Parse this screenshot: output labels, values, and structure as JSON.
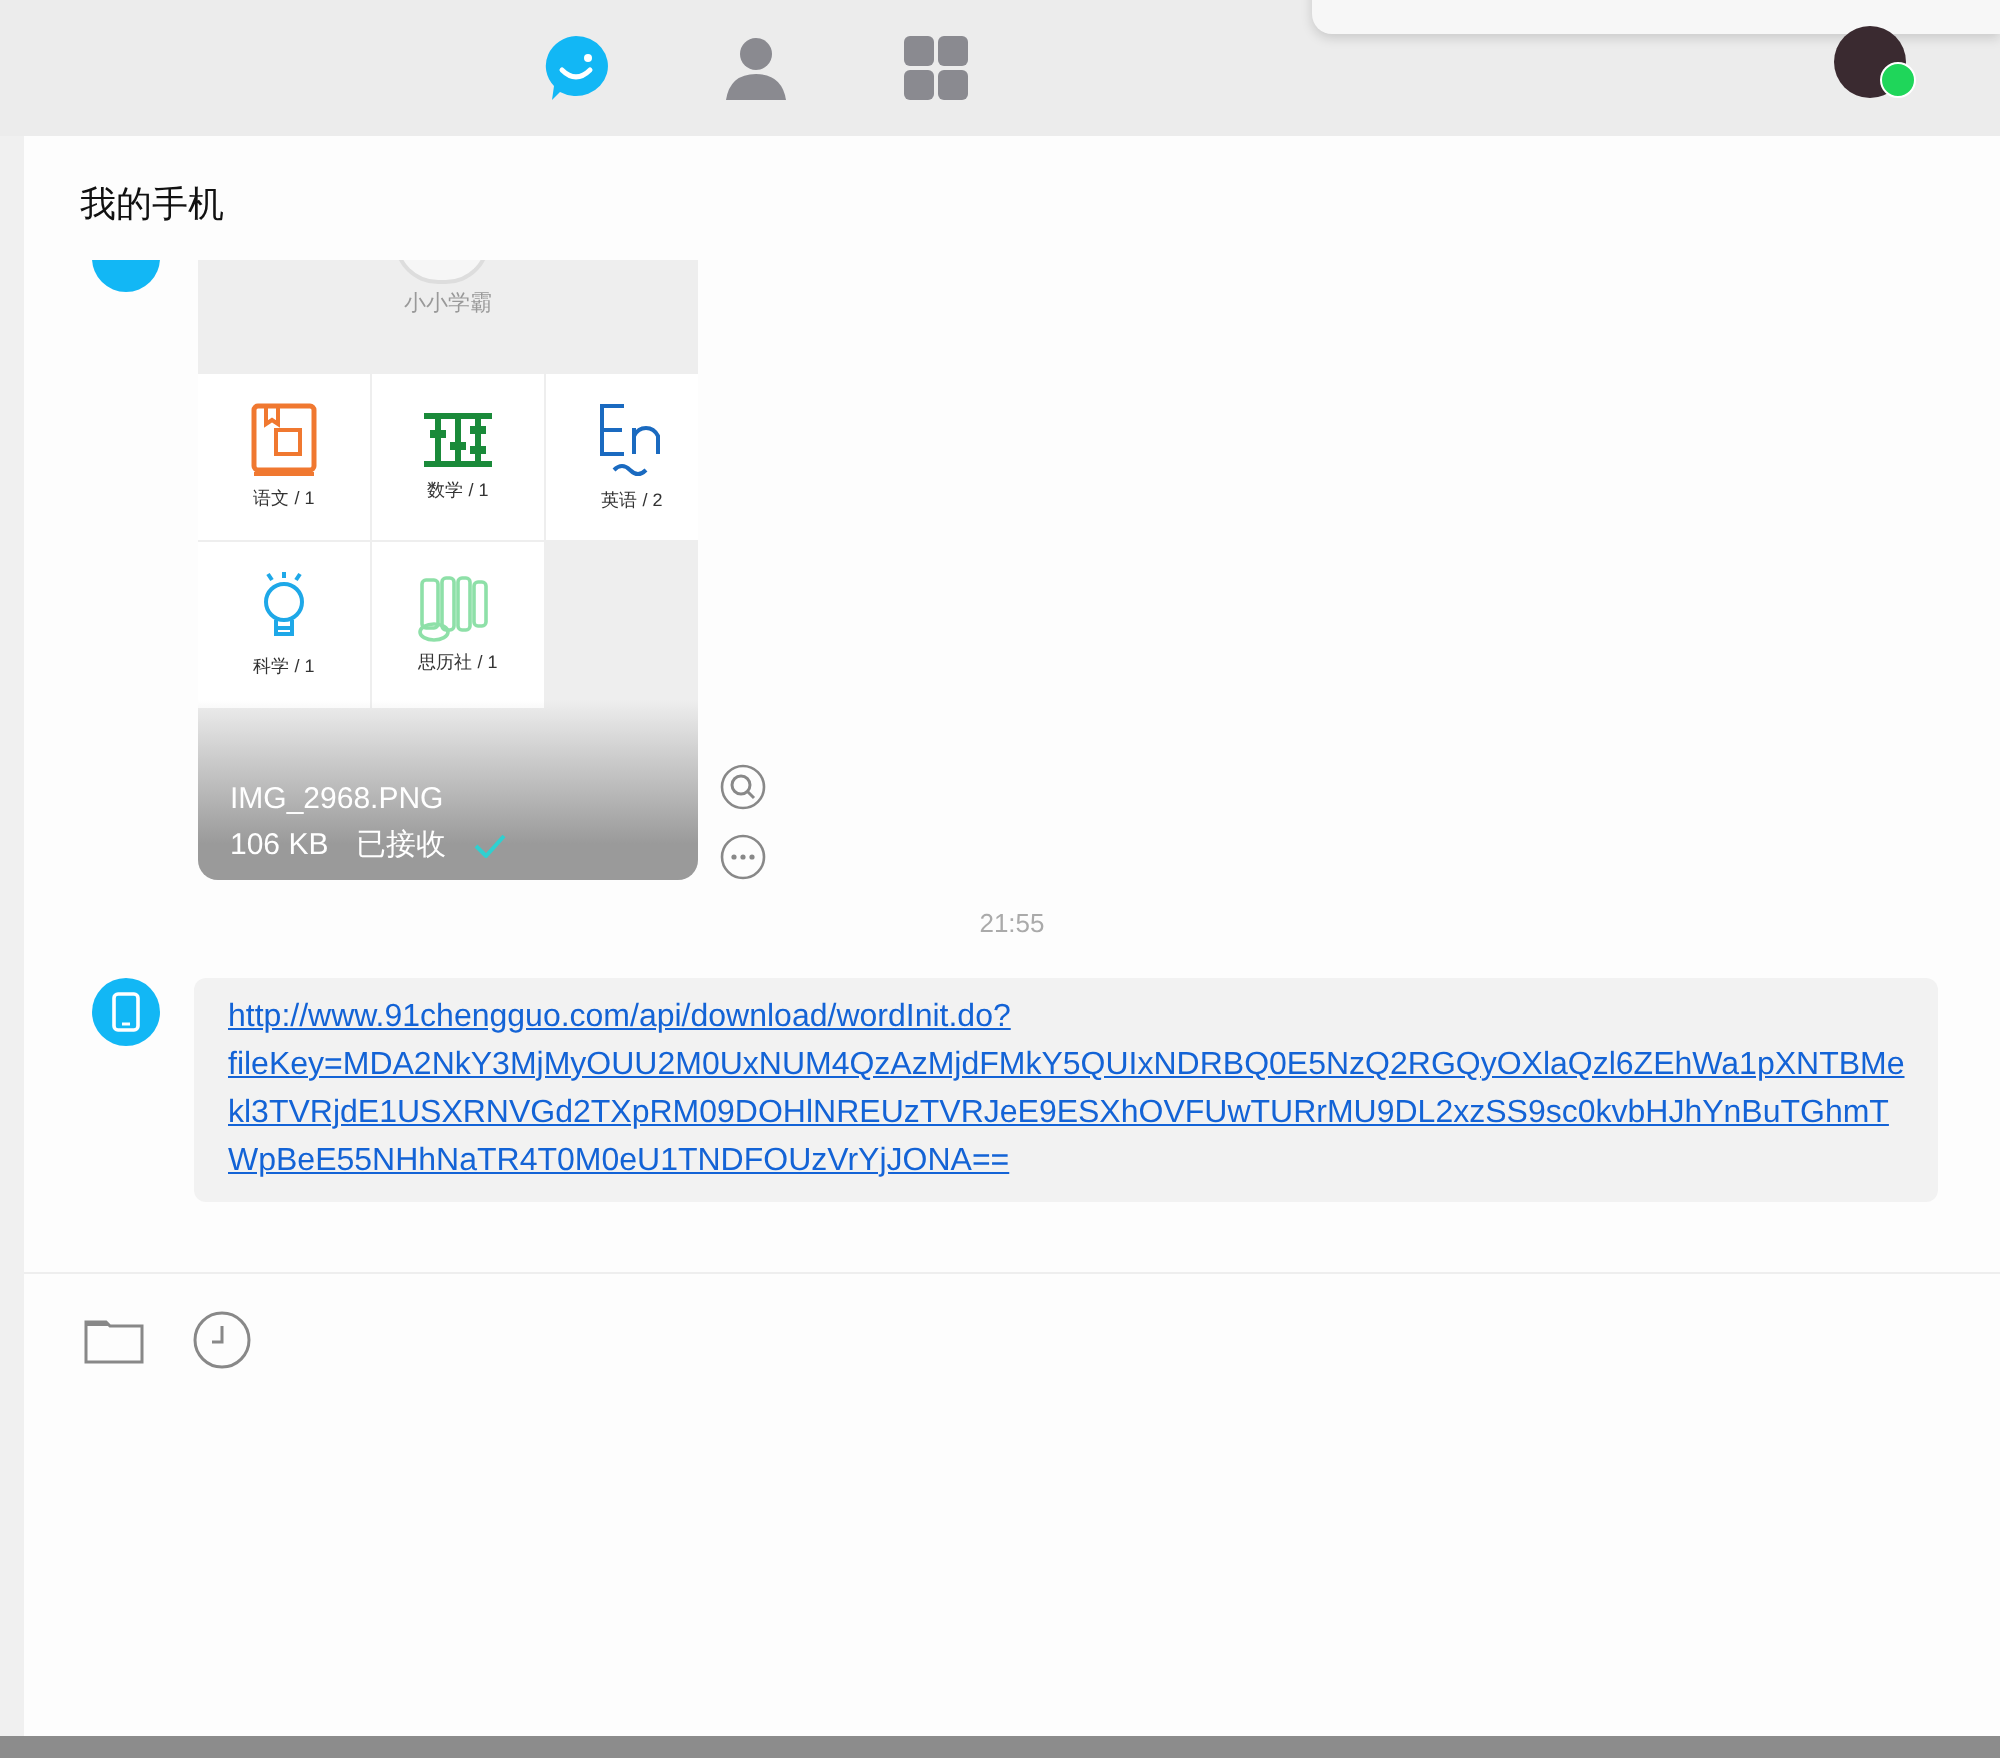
{
  "nav_tabs": [
    {
      "kind": "chat",
      "selected": true
    },
    {
      "kind": "contacts",
      "selected": false
    },
    {
      "kind": "apps",
      "selected": false
    }
  ],
  "conversation": {
    "title": "我的手机"
  },
  "messages": [
    {
      "kind": "image",
      "app_title": "小小学霸",
      "subjects": [
        {
          "kind": "chinese",
          "label": "语文 / 1"
        },
        {
          "kind": "math",
          "label": "数学 / 1"
        },
        {
          "kind": "english",
          "label": "英语 / 2"
        },
        {
          "kind": "science",
          "label": "科学 / 1"
        },
        {
          "kind": "social",
          "label": "思历社 / 1"
        }
      ],
      "file_name": "IMG_2968.PNG",
      "file_size": "106 KB",
      "status": "已接收",
      "received": true
    },
    {
      "kind": "time",
      "text": "21:55"
    },
    {
      "kind": "link",
      "text": "http://www.91chengguo.com/api/download/wordInit.do?fileKey=MDA2NkY3MjMyOUU2M0UxNUM4QzAzMjdFMkY5QUIxNDRBQ0E5NzQ2RGQyOXlaQzl6ZEhWa1pXNTBMekl3TVRjdE1USXRNVGd2TXpRM09DOHlNREUzTVRJeE9ESXhOVFUwTURrMU9DL2xzSS9sc0kvbHJhYnBuTGhmTWpBeE55NHhNaTR4T0M0eU1TNDFOUzVrYjJONA=="
    }
  ]
}
